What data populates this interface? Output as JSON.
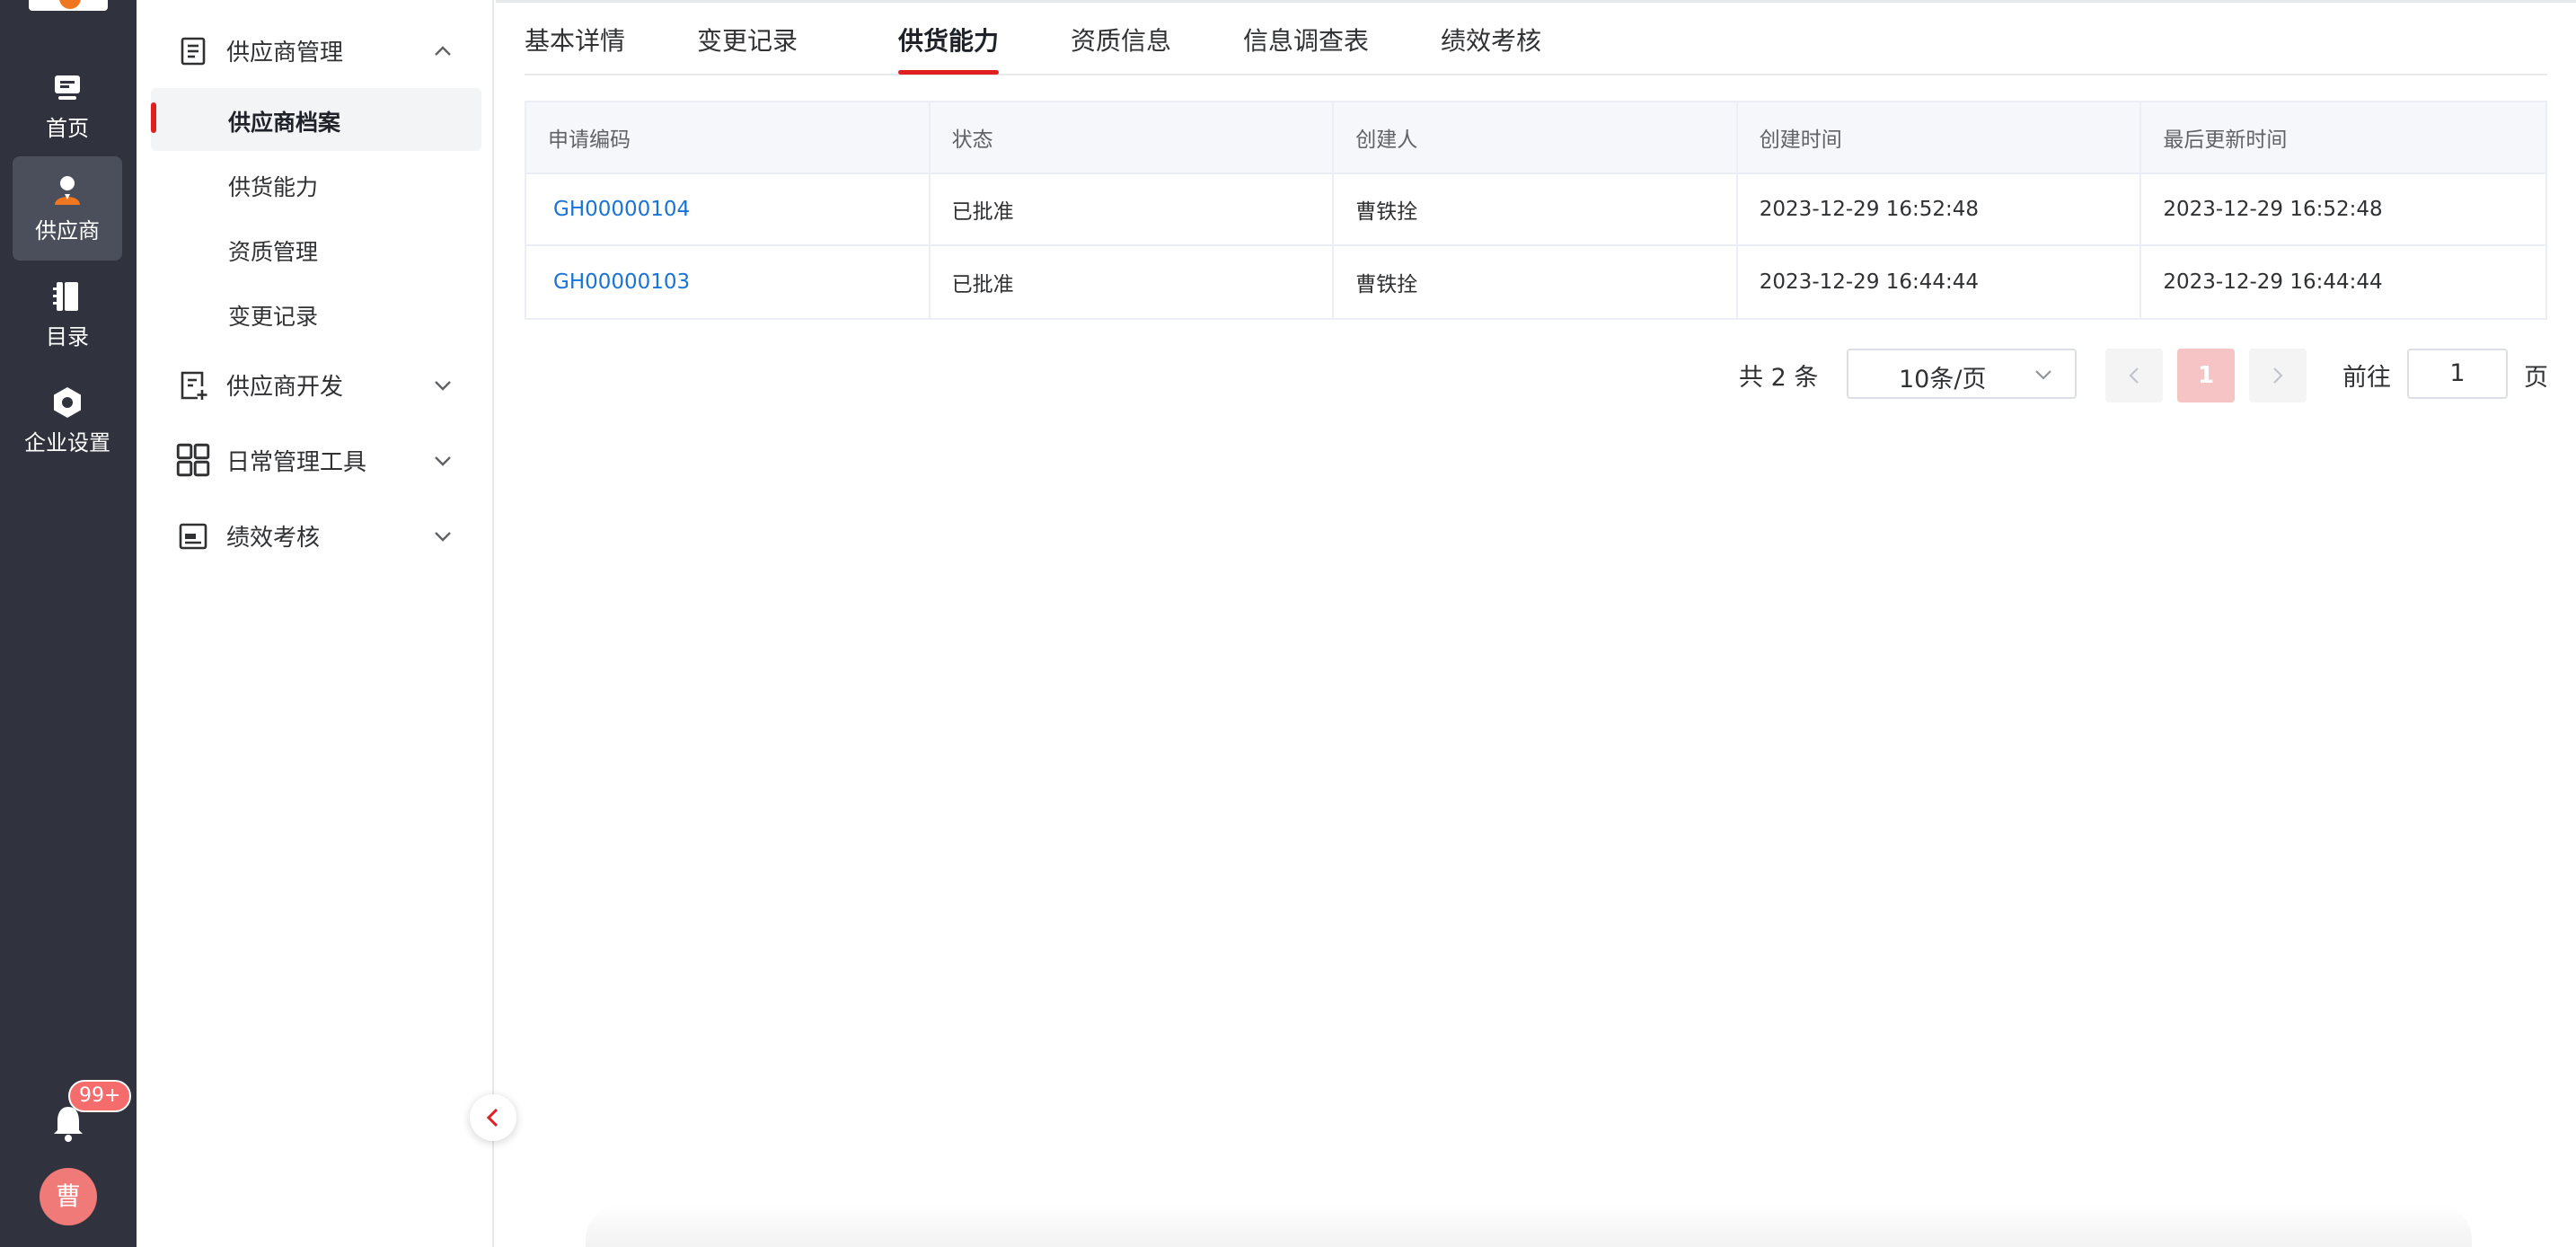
{
  "rail": {
    "items": [
      {
        "label": "首页",
        "icon": "monitor-icon"
      },
      {
        "label": "供应商",
        "icon": "supplier-user-icon",
        "active": true
      },
      {
        "label": "目录",
        "icon": "catalog-book-icon"
      },
      {
        "label": "企业设置",
        "icon": "settings-hex-icon"
      }
    ],
    "notification_badge": "99+",
    "avatar_text": "曹",
    "accent_color": "#f0761f"
  },
  "submenu": {
    "groups": [
      {
        "label": "供应商管理",
        "icon": "document-list-icon",
        "expanded": true
      },
      {
        "label": "供应商开发",
        "icon": "document-add-icon",
        "expanded": false
      },
      {
        "label": "日常管理工具",
        "icon": "grid-apps-icon",
        "expanded": false
      },
      {
        "label": "绩效考核",
        "icon": "id-card-icon",
        "expanded": false
      }
    ],
    "items": [
      {
        "label": "供应商档案",
        "active": true
      },
      {
        "label": "供货能力"
      },
      {
        "label": "资质管理"
      },
      {
        "label": "变更记录"
      }
    ]
  },
  "tabs": [
    {
      "label": "基本详情"
    },
    {
      "label": "变更记录"
    },
    {
      "label": "供货能力",
      "active": true
    },
    {
      "label": "资质信息"
    },
    {
      "label": "信息调查表"
    },
    {
      "label": "绩效考核"
    }
  ],
  "table": {
    "columns": [
      "申请编码",
      "状态",
      "创建人",
      "创建时间",
      "最后更新时间"
    ],
    "rows": [
      [
        "GH00000104",
        "已批准",
        "曹铁拴",
        "2023-12-29 16:52:48",
        "2023-12-29 16:52:48"
      ],
      [
        "GH00000103",
        "已批准",
        "曹铁拴",
        "2023-12-29 16:44:44",
        "2023-12-29 16:44:44"
      ]
    ]
  },
  "pagination": {
    "total_text": "共 2 条",
    "page_size": "10条/页",
    "current_page": "1",
    "goto_label": "前往",
    "goto_value": "1",
    "page_suffix": "页"
  },
  "colors": {
    "brand_red": "#e02020",
    "link_blue": "#1a73d6",
    "rail_bg": "#30333d"
  }
}
